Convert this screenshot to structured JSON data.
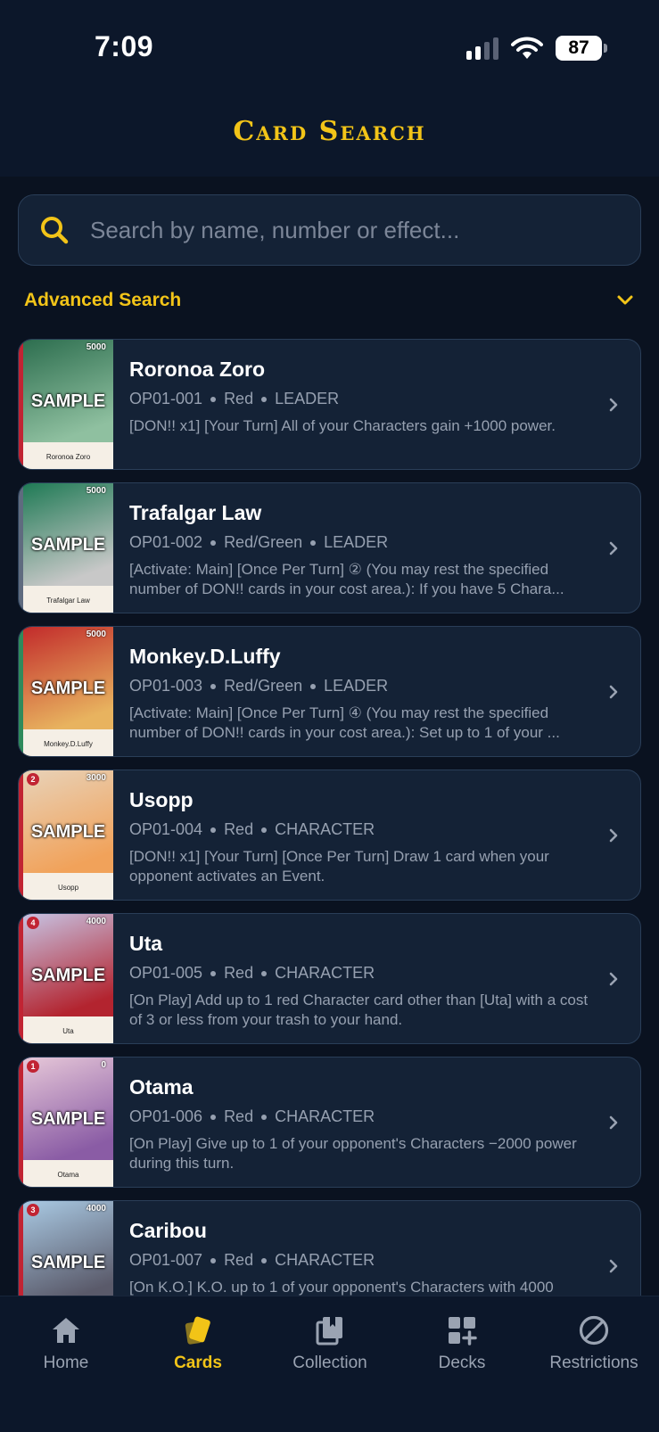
{
  "status": {
    "time": "7:09",
    "battery": "87"
  },
  "header": {
    "title": "Card Search"
  },
  "search": {
    "placeholder": "Search by name, number or effect..."
  },
  "advanced": {
    "label": "Advanced Search"
  },
  "colors": {
    "accent": "#f2c418",
    "background": "#0a1220",
    "card": "#142236",
    "border": "#2a3e58"
  },
  "cards": [
    {
      "name": "Roronoa Zoro",
      "number": "OP01-001",
      "color": "Red",
      "type": "LEADER",
      "power": "5000",
      "cost": "",
      "thumb_label": "SAMPLE",
      "thumb_name": "Roronoa Zoro",
      "effect": "[DON!! x1] [Your Turn] All of your Characters gain +1000 power."
    },
    {
      "name": "Trafalgar Law",
      "number": "OP01-002",
      "color": "Red/Green",
      "type": "LEADER",
      "power": "5000",
      "cost": "",
      "thumb_label": "SAMPLE",
      "thumb_name": "Trafalgar Law",
      "effect": "[Activate: Main] [Once Per Turn] ② (You may rest the specified number of DON!! cards in your cost area.): If you have 5 Chara..."
    },
    {
      "name": "Monkey.D.Luffy",
      "number": "OP01-003",
      "color": "Red/Green",
      "type": "LEADER",
      "power": "5000",
      "cost": "",
      "thumb_label": "SAMPLE",
      "thumb_name": "Monkey.D.Luffy",
      "effect": "[Activate: Main] [Once Per Turn] ④ (You may rest the specified number of DON!! cards in your cost area.): Set up to 1 of your ..."
    },
    {
      "name": "Usopp",
      "number": "OP01-004",
      "color": "Red",
      "type": "CHARACTER",
      "power": "3000",
      "cost": "2",
      "thumb_label": "SAMPLE",
      "thumb_name": "Usopp",
      "effect": "[DON!! x1] [Your Turn] [Once Per Turn] Draw 1 card when your opponent activates an Event."
    },
    {
      "name": "Uta",
      "number": "OP01-005",
      "color": "Red",
      "type": "CHARACTER",
      "power": "4000",
      "cost": "4",
      "thumb_label": "SAMPLE",
      "thumb_name": "Uta",
      "effect": "[On Play] Add up to 1 red Character card other than [Uta] with a cost of 3 or less from your trash to your hand."
    },
    {
      "name": "Otama",
      "number": "OP01-006",
      "color": "Red",
      "type": "CHARACTER",
      "power": "0",
      "cost": "1",
      "thumb_label": "SAMPLE",
      "thumb_name": "Otama",
      "effect": "[On Play] Give up to 1 of your opponent's Characters −2000 power during this turn."
    },
    {
      "name": "Caribou",
      "number": "OP01-007",
      "color": "Red",
      "type": "CHARACTER",
      "power": "4000",
      "cost": "3",
      "thumb_label": "SAMPLE",
      "thumb_name": "",
      "effect": "[On K.O.] K.O. up to 1 of your opponent's Characters with 4000"
    }
  ],
  "nav": {
    "items": [
      {
        "label": "Home",
        "icon": "home-icon"
      },
      {
        "label": "Cards",
        "icon": "cards-icon"
      },
      {
        "label": "Collection",
        "icon": "collection-icon"
      },
      {
        "label": "Decks",
        "icon": "decks-icon"
      },
      {
        "label": "Restrictions",
        "icon": "restrictions-icon"
      }
    ],
    "active": "Cards"
  }
}
